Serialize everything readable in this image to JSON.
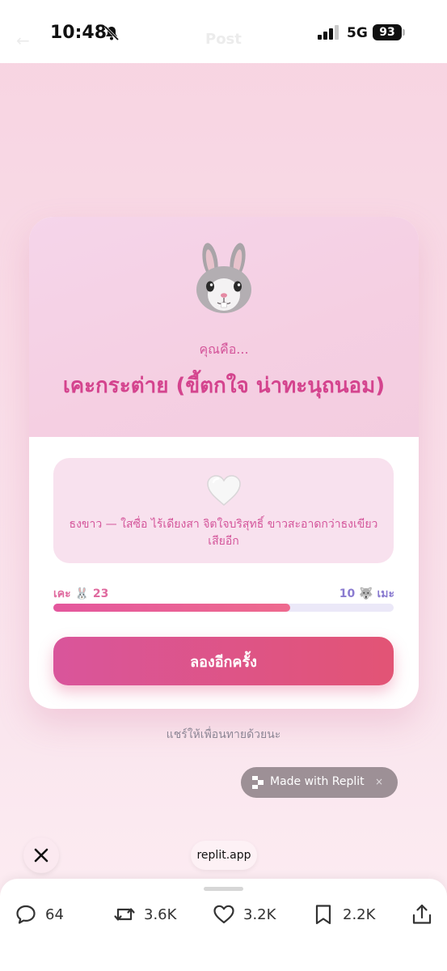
{
  "status_bar": {
    "time": "10:48",
    "network": "5G",
    "battery": "93",
    "faded_title": "Post"
  },
  "result": {
    "animal_icon": "rabbit-face-emoji",
    "kicker": "คุณคือ...",
    "title": "เคะกระต่าย (ขี้ตกใจ น่าทะนุถนอม)",
    "description_icon": "white-heart-emoji",
    "description": "ธงขาว — ใสซื่อ ไร้เดียงสา จิตใจบริสุทธิ์ ขาวสะอาดกว่าธงเขียวเสียอีก",
    "score_left_label": "เคะ 🐰 23",
    "score_right_label": "10 🐺 เมะ",
    "score_left": 23,
    "score_right": 10,
    "retry_label": "ลองอีกครั้ง"
  },
  "share_hint": "แชร์ให้เพื่อนทายด้วยนะ",
  "replit_badge": {
    "label": "Made with Replit",
    "close": "×"
  },
  "url_pill": "replit.app",
  "actions": {
    "replies": "64",
    "reposts": "3.6K",
    "likes": "3.2K",
    "bookmarks": "2.2K"
  },
  "colors": {
    "accent_pink": "#d4448e",
    "button_gradient_start": "#d9559b",
    "button_gradient_end": "#e25475",
    "meter_right": "#8a7bd0"
  }
}
